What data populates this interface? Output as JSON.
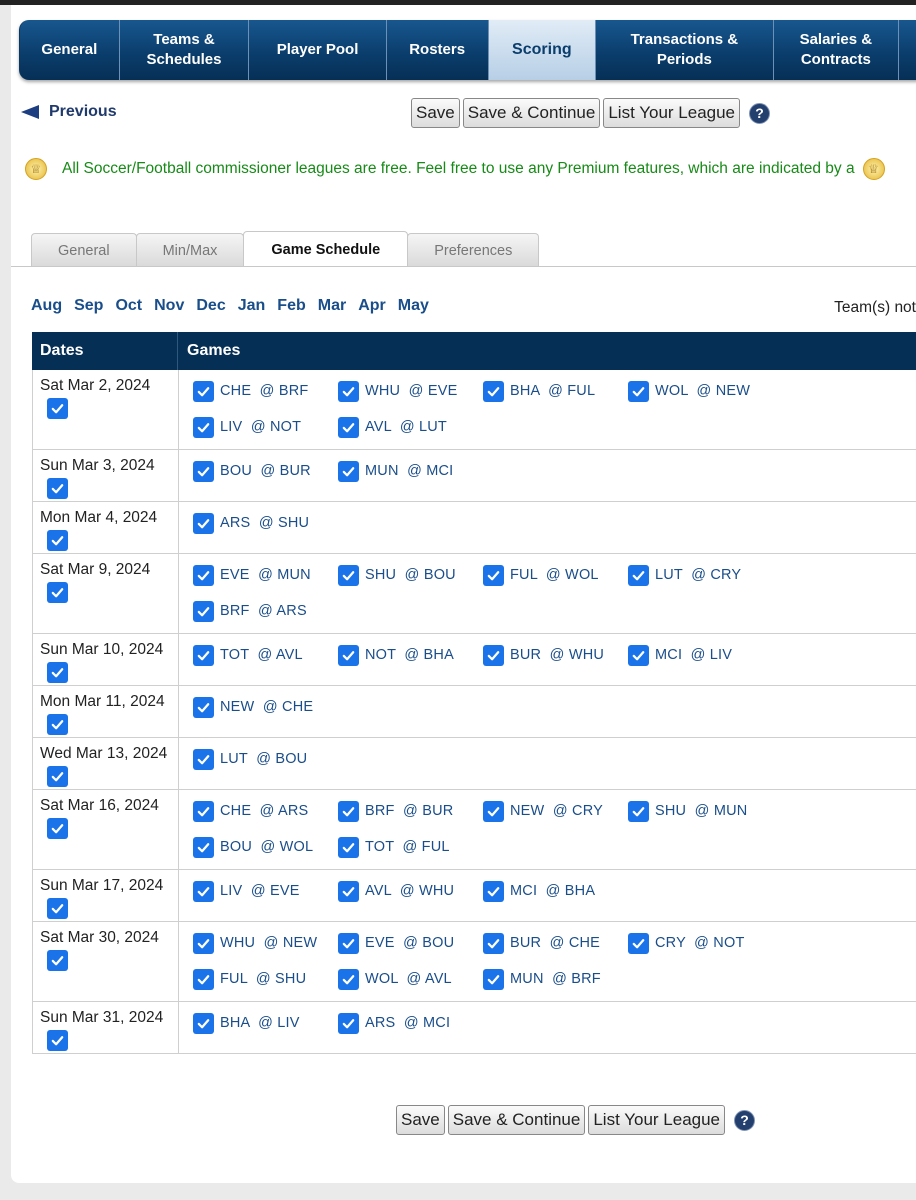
{
  "nav": {
    "tabs": [
      {
        "label": "General",
        "active": false
      },
      {
        "label": "Teams & Schedules",
        "active": false
      },
      {
        "label": "Player Pool",
        "active": false
      },
      {
        "label": "Rosters",
        "active": false
      },
      {
        "label": "Scoring",
        "active": true
      },
      {
        "label": "Transactions & Periods",
        "active": false
      },
      {
        "label": "Salaries & Contracts",
        "active": false
      }
    ]
  },
  "previous_label": "Previous",
  "buttons": {
    "save": "Save",
    "save_continue": "Save & Continue",
    "list_league": "List Your League",
    "help": "?"
  },
  "notice": "All Soccer/Football commissioner leagues are free. Feel free to use any Premium features, which are indicated by a",
  "subtabs": [
    {
      "label": "General",
      "active": false
    },
    {
      "label": "Min/Max",
      "active": false
    },
    {
      "label": "Game Schedule",
      "active": true
    },
    {
      "label": "Preferences",
      "active": false
    }
  ],
  "months": [
    "Aug",
    "Sep",
    "Oct",
    "Nov",
    "Dec",
    "Jan",
    "Feb",
    "Mar",
    "Apr",
    "May"
  ],
  "teams_not_label": "Team(s) not",
  "schedule": {
    "headers": {
      "dates": "Dates",
      "games": "Games"
    },
    "rows": [
      {
        "date": "Sat Mar 2, 2024",
        "checked": true,
        "games": [
          "CHE @ BRF",
          "WHU @ EVE",
          "BHA @ FUL",
          "WOL @ NEW",
          "LIV @ NOT",
          "AVL @ LUT"
        ]
      },
      {
        "date": "Sun Mar 3, 2024",
        "checked": true,
        "games": [
          "BOU @ BUR",
          "MUN @ MCI"
        ]
      },
      {
        "date": "Mon Mar 4, 2024",
        "checked": true,
        "games": [
          "ARS @ SHU"
        ]
      },
      {
        "date": "Sat Mar 9, 2024",
        "checked": true,
        "games": [
          "EVE @ MUN",
          "SHU @ BOU",
          "FUL @ WOL",
          "LUT @ CRY",
          "BRF @ ARS"
        ]
      },
      {
        "date": "Sun Mar 10, 2024",
        "checked": true,
        "games": [
          "TOT @ AVL",
          "NOT @ BHA",
          "BUR @ WHU",
          "MCI @ LIV"
        ]
      },
      {
        "date": "Mon Mar 11, 2024",
        "checked": true,
        "games": [
          "NEW @ CHE"
        ]
      },
      {
        "date": "Wed Mar 13, 2024",
        "checked": true,
        "games": [
          "LUT @ BOU"
        ]
      },
      {
        "date": "Sat Mar 16, 2024",
        "checked": true,
        "games": [
          "CHE @ ARS",
          "BRF @ BUR",
          "NEW @ CRY",
          "SHU @ MUN",
          "BOU @ WOL",
          "TOT @ FUL"
        ]
      },
      {
        "date": "Sun Mar 17, 2024",
        "checked": true,
        "games": [
          "LIV @ EVE",
          "AVL @ WHU",
          "MCI @ BHA"
        ]
      },
      {
        "date": "Sat Mar 30, 2024",
        "checked": true,
        "games": [
          "WHU @ NEW",
          "EVE @ BOU",
          "BUR @ CHE",
          "CRY @ NOT",
          "FUL @ SHU",
          "WOL @ AVL",
          "MUN @ BRF"
        ]
      },
      {
        "date": "Sun Mar 31, 2024",
        "checked": true,
        "games": [
          "BHA @ LIV",
          "ARS @ MCI"
        ]
      }
    ]
  },
  "colors": {
    "nav_dark": "#062f55",
    "checkbox": "#1a73e8",
    "notice_green": "#178a17",
    "link_blue": "#1a4e8a"
  }
}
